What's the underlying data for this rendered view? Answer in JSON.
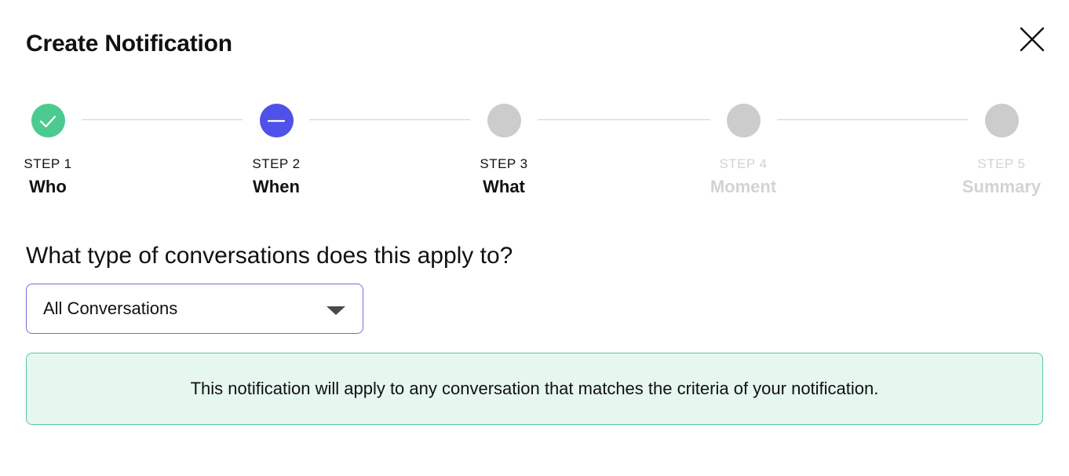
{
  "dialog": {
    "title": "Create Notification",
    "close_icon": "close-icon"
  },
  "colors": {
    "done": "#4ccb91",
    "active": "#4f52e8",
    "pending": "#cccccc",
    "disabled_text": "#d3d3d3",
    "select_border": "#6d6fe0",
    "info_bg": "#e6f7f0",
    "info_border": "#58c99a"
  },
  "stepper": {
    "steps": [
      {
        "number": "STEP 1",
        "name": "Who",
        "status": "done",
        "icon": "check-icon"
      },
      {
        "number": "STEP 2",
        "name": "When",
        "status": "active",
        "icon": "minus-icon"
      },
      {
        "number": "STEP 3",
        "name": "What",
        "status": "pending",
        "icon": ""
      },
      {
        "number": "STEP 4",
        "name": "Moment",
        "status": "disabled",
        "icon": ""
      },
      {
        "number": "STEP 5",
        "name": "Summary",
        "status": "disabled",
        "icon": ""
      }
    ]
  },
  "form": {
    "question": "What type of conversations does this apply to?",
    "conversation_type": {
      "selected": "All Conversations",
      "icon": "chevron-down-icon"
    },
    "info_message": "This notification will apply to any conversation that matches the criteria of your notification."
  }
}
